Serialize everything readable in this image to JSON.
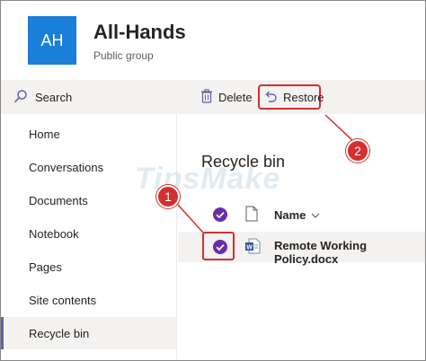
{
  "header": {
    "avatar_initials": "AH",
    "avatar_color": "#1a7fd8",
    "title": "All-Hands",
    "subtitle": "Public group"
  },
  "command_bar": {
    "search_label": "Search",
    "delete_label": "Delete",
    "restore_label": "Restore",
    "icons": {
      "search": "search-icon",
      "delete": "trash-icon",
      "restore": "undo-icon"
    }
  },
  "left_nav": {
    "items": [
      {
        "label": "Home"
      },
      {
        "label": "Conversations"
      },
      {
        "label": "Documents"
      },
      {
        "label": "Notebook"
      },
      {
        "label": "Pages"
      },
      {
        "label": "Site contents"
      },
      {
        "label": "Recycle bin",
        "active": true
      }
    ],
    "accent": "#6264a7"
  },
  "main": {
    "title": "Recycle bin",
    "columns": {
      "name": "Name"
    },
    "rows": [
      {
        "name": "Remote Working Policy.docx",
        "selected": true,
        "icon": "word-document-icon"
      }
    ]
  },
  "annotations": {
    "step1": "1",
    "step2": "2",
    "color": "#d32f2f"
  },
  "watermark": "TipsMake"
}
